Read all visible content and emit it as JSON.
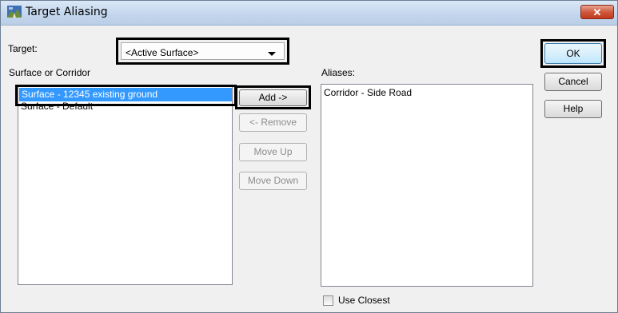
{
  "window": {
    "title": "Target Aliasing",
    "close_glyph": "✕"
  },
  "target": {
    "label": "Target:",
    "selected": "<Active Surface>"
  },
  "surface_list": {
    "label": "Surface or Corridor",
    "items": [
      "Surface - 12345 existing ground",
      "Surface - Default"
    ],
    "selected_index": 0
  },
  "aliases_list": {
    "label": "Aliases:",
    "items": [
      "Corridor - Side Road"
    ]
  },
  "buttons": {
    "add": "Add ->",
    "remove": "<- Remove",
    "move_up": "Move Up",
    "move_down": "Move Down",
    "ok": "OK",
    "cancel": "Cancel",
    "help": "Help"
  },
  "use_closest": {
    "label": "Use Closest",
    "checked": false
  }
}
